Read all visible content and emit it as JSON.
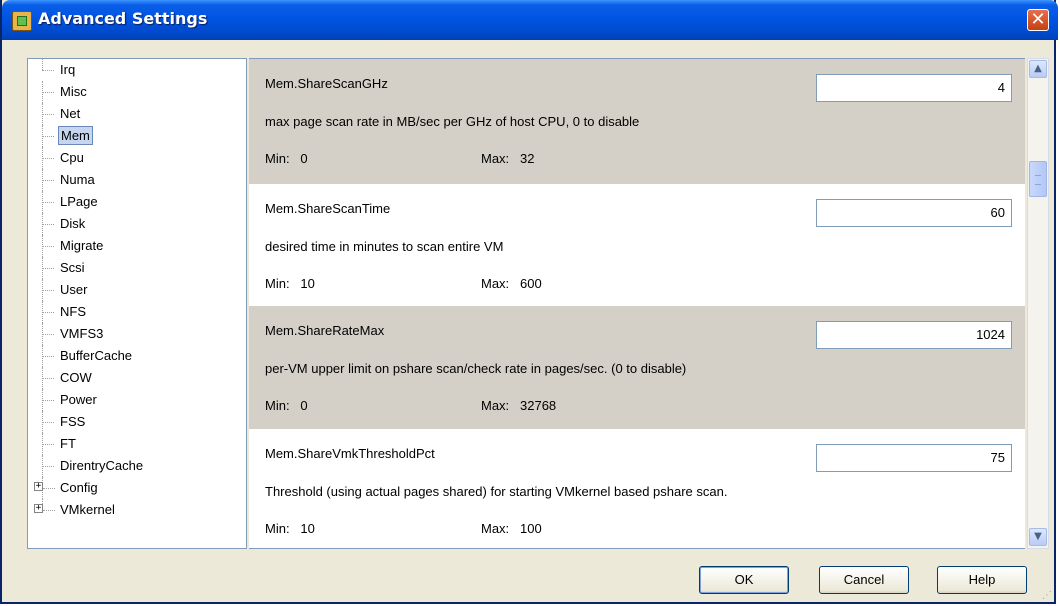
{
  "window": {
    "title": "Advanced Settings",
    "close_glyph": "✕"
  },
  "tree": {
    "items": [
      {
        "label": "Irq",
        "expandable": false,
        "selected": false
      },
      {
        "label": "Misc",
        "expandable": false,
        "selected": false
      },
      {
        "label": "Net",
        "expandable": false,
        "selected": false
      },
      {
        "label": "Mem",
        "expandable": false,
        "selected": true
      },
      {
        "label": "Cpu",
        "expandable": false,
        "selected": false
      },
      {
        "label": "Numa",
        "expandable": false,
        "selected": false
      },
      {
        "label": "LPage",
        "expandable": false,
        "selected": false
      },
      {
        "label": "Disk",
        "expandable": false,
        "selected": false
      },
      {
        "label": "Migrate",
        "expandable": false,
        "selected": false
      },
      {
        "label": "Scsi",
        "expandable": false,
        "selected": false
      },
      {
        "label": "User",
        "expandable": false,
        "selected": false
      },
      {
        "label": "NFS",
        "expandable": false,
        "selected": false
      },
      {
        "label": "VMFS3",
        "expandable": false,
        "selected": false
      },
      {
        "label": "BufferCache",
        "expandable": false,
        "selected": false
      },
      {
        "label": "COW",
        "expandable": false,
        "selected": false
      },
      {
        "label": "Power",
        "expandable": false,
        "selected": false
      },
      {
        "label": "FSS",
        "expandable": false,
        "selected": false
      },
      {
        "label": "FT",
        "expandable": false,
        "selected": false
      },
      {
        "label": "DirentryCache",
        "expandable": false,
        "selected": false
      },
      {
        "label": "Config",
        "expandable": true,
        "selected": false
      },
      {
        "label": "VMkernel",
        "expandable": true,
        "selected": false
      }
    ],
    "expander_glyph": "+"
  },
  "settings": [
    {
      "name": "Mem.ShareScanGHz",
      "value": "4",
      "description": "max page scan rate in MB/sec per GHz of host CPU, 0 to disable",
      "min_text": "Min:   0",
      "max_text": "Max:   32"
    },
    {
      "name": "Mem.ShareScanTime",
      "value": "60",
      "description": "desired time in minutes to scan entire VM",
      "min_text": "Min:   10",
      "max_text": "Max:   600"
    },
    {
      "name": "Mem.ShareRateMax",
      "value": "1024",
      "description": "per-VM upper limit on pshare scan/check rate in pages/sec. (0 to disable)",
      "min_text": "Min:   0",
      "max_text": "Max:   32768"
    },
    {
      "name": "Mem.ShareVmkThresholdPct",
      "value": "75",
      "description": "Threshold (using actual pages shared) for starting VMkernel based pshare scan.",
      "min_text": "Min:   10",
      "max_text": "Max:   100"
    }
  ],
  "scrollbar": {
    "up_glyph": "▲",
    "down_glyph": "▼"
  },
  "buttons": {
    "ok": "OK",
    "cancel": "Cancel",
    "help": "Help"
  },
  "colors": {
    "title_bar": "#0054e3",
    "shaded_row": "#d4d0c8",
    "selection": "#c6d6ef",
    "close_button": "#d54a1f"
  }
}
